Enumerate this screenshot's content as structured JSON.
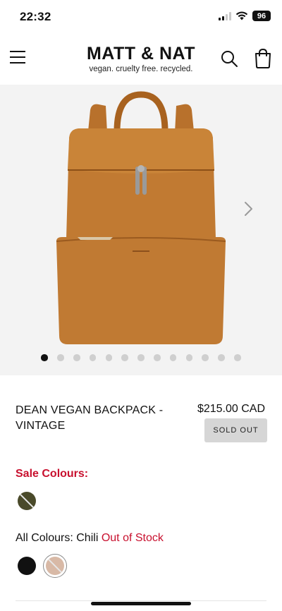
{
  "status": {
    "time": "22:32",
    "battery": "96"
  },
  "header": {
    "brand_name": "MATT & NAT",
    "brand_tagline": "vegan. cruelty free. recycled.",
    "icons": [
      "menu-icon",
      "search-icon",
      "shopping-bag-icon"
    ]
  },
  "gallery": {
    "image": "brown-leather-backpack",
    "dot_count": 13,
    "active_dot": 0,
    "next_icon": "chevron-right-icon"
  },
  "product": {
    "title": "DEAN VEGAN BACKPACK - VINTAGE",
    "price": "$215.00 CAD",
    "sold_out_label": "SOLD OUT"
  },
  "colours": {
    "sale_label": "Sale Colours:",
    "all_prefix": "All Colours: ",
    "selected": "Chili",
    "stock_status": "Out of Stock",
    "accent": "#c8102e"
  }
}
